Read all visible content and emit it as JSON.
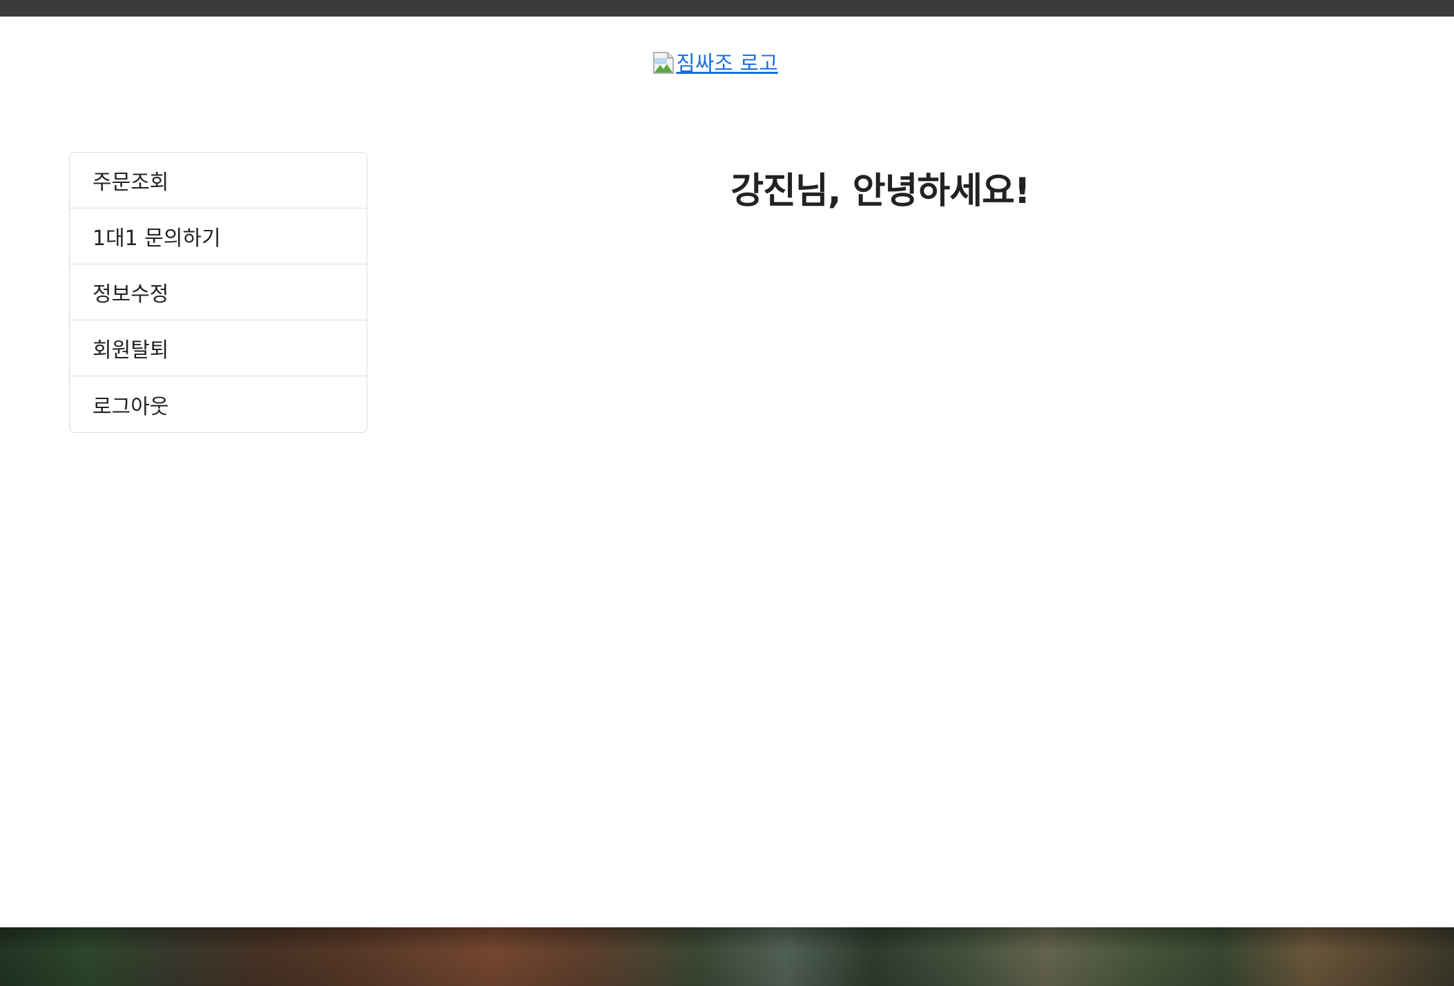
{
  "header": {
    "logo_alt": "짐싸조 로고"
  },
  "sidebar": {
    "items": [
      {
        "label": "주문조회"
      },
      {
        "label": "1대1 문의하기"
      },
      {
        "label": "정보수정"
      },
      {
        "label": "회원탈퇴"
      },
      {
        "label": "로그아웃"
      }
    ]
  },
  "main": {
    "greeting": "강진님, 안녕하세요!"
  },
  "colors": {
    "topbar": "#3b3b3b",
    "link": "#1a6fe0",
    "border": "#dcdcdc"
  }
}
